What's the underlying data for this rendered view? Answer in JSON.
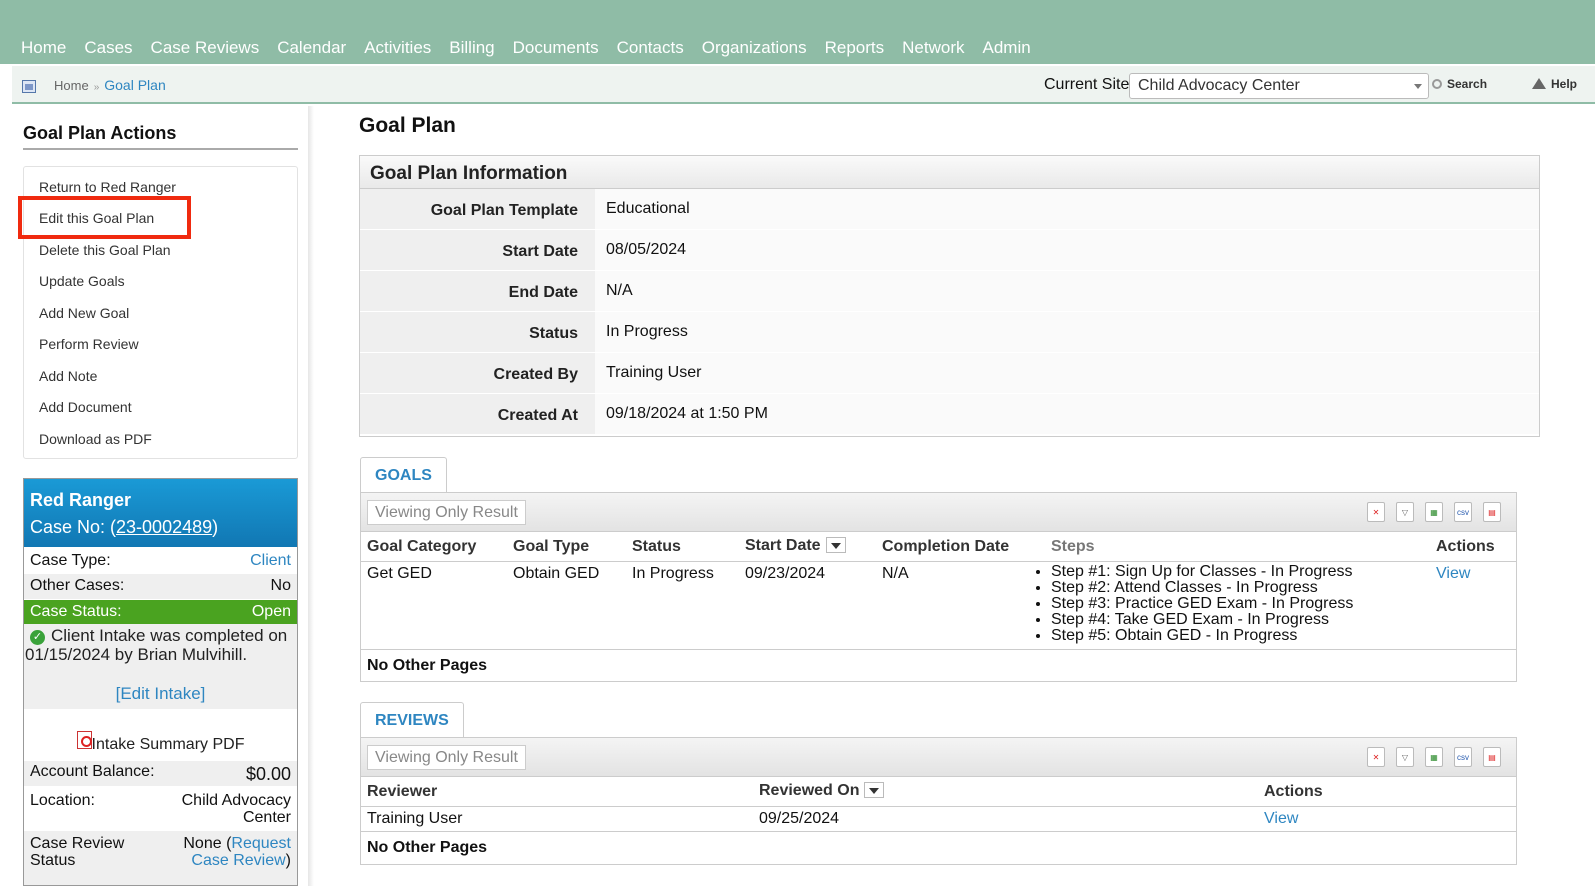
{
  "nav": {
    "items": [
      "Home",
      "Cases",
      "Case Reviews",
      "Calendar",
      "Activities",
      "Billing",
      "Documents",
      "Contacts",
      "Organizations",
      "Reports",
      "Network",
      "Admin"
    ]
  },
  "breadcrumb": {
    "home": "Home",
    "sep": "»",
    "current": "Goal Plan"
  },
  "site": {
    "label": "Current Site",
    "selected": "Child Advocacy Center"
  },
  "tools": {
    "search": "Search",
    "help": "Help"
  },
  "sidebar": {
    "title": "Goal Plan Actions",
    "actions": [
      "Return to Red Ranger",
      "Edit this Goal Plan",
      "Delete this Goal Plan",
      "Update Goals",
      "Add New Goal",
      "Perform Review",
      "Add Note",
      "Add Document",
      "Download as PDF"
    ]
  },
  "case_card": {
    "name": "Red Ranger",
    "case_no_label": "Case No: (",
    "case_no": "23-0002489",
    "case_no_close": ")",
    "case_type_label": "Case Type:",
    "case_type": "Client",
    "other_cases_label": "Other Cases:",
    "other_cases": "No",
    "status_label": "Case Status:",
    "status": "Open",
    "intake_msg": "Client Intake was completed on 01/15/2024 by Brian Mulvihill.",
    "edit_intake": "[Edit Intake]",
    "intake_pdf": "Intake Summary PDF",
    "balance_label": "Account Balance:",
    "balance": "$0.00",
    "location_label": "Location:",
    "location_line1": "Child Advocacy",
    "location_line2": "Center",
    "review_label_1": "Case Review",
    "review_label_2": "Status",
    "review_none": "None (",
    "review_link_1": "Request",
    "review_link_2": "Case Review",
    "review_close": ")"
  },
  "main": {
    "title": "Goal Plan",
    "info_title": "Goal Plan Information",
    "info_rows": [
      {
        "label": "Goal Plan Template",
        "value": "Educational"
      },
      {
        "label": "Start Date",
        "value": "08/05/2024"
      },
      {
        "label": "End Date",
        "value": "N/A"
      },
      {
        "label": "Status",
        "value": "In Progress"
      },
      {
        "label": "Created By",
        "value": "Training User"
      },
      {
        "label": "Created At",
        "value": "09/18/2024 at 1:50 PM"
      }
    ]
  },
  "goals": {
    "tab": "GOALS",
    "viewing": "Viewing Only Result",
    "headers": [
      "Goal Category",
      "Goal Type",
      "Status",
      "Start Date",
      "Completion Date",
      "Steps",
      "Actions"
    ],
    "row": {
      "category": "Get GED",
      "type": "Obtain GED",
      "status": "In Progress",
      "start": "09/23/2024",
      "completion": "N/A",
      "steps": [
        "Step #1: Sign Up for Classes - In Progress",
        "Step #2: Attend Classes - In Progress",
        "Step #3: Practice GED Exam - In Progress",
        "Step #4: Take GED Exam - In Progress",
        "Step #5: Obtain GED - In Progress"
      ],
      "action": "View"
    },
    "footer": "No Other Pages"
  },
  "reviews": {
    "tab": "REVIEWS",
    "viewing": "Viewing Only Result",
    "headers": [
      "Reviewer",
      "Reviewed On",
      "Actions"
    ],
    "row": {
      "reviewer": "Training User",
      "reviewed_on": "09/25/2024",
      "action": "View"
    },
    "footer": "No Other Pages"
  },
  "grid_icons": {
    "csv": "csv"
  },
  "colors": {
    "nav": "#8fbca6",
    "link": "#2e86c1",
    "card_head": "#1a9ad6",
    "status_open": "#4aa320",
    "highlight": "#f02a0f"
  }
}
